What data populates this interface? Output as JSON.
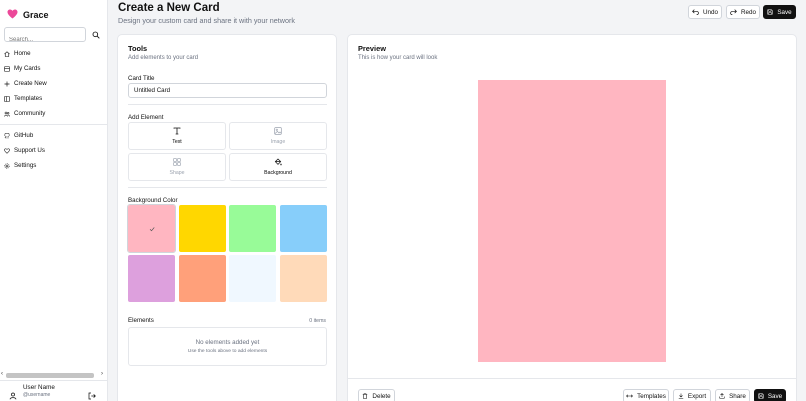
{
  "brand": {
    "name": "Grace",
    "logo_color": "#ec4899"
  },
  "search": {
    "placeholder": "Search..."
  },
  "nav": {
    "items": [
      {
        "label": "Home",
        "icon": "home-icon"
      },
      {
        "label": "My Cards",
        "icon": "cards-icon"
      },
      {
        "label": "Create New",
        "icon": "plus-icon"
      },
      {
        "label": "Templates",
        "icon": "template-icon"
      },
      {
        "label": "Community",
        "icon": "community-icon"
      }
    ],
    "secondary": [
      {
        "label": "GitHub",
        "icon": "github-icon"
      },
      {
        "label": "Support Us",
        "icon": "heart-icon"
      },
      {
        "label": "Settings",
        "icon": "gear-icon"
      }
    ]
  },
  "user": {
    "name": "User Name",
    "handle": "@username"
  },
  "header": {
    "title": "Create a New Card",
    "subtitle": "Design your custom card and share it with your network",
    "undo_label": "Undo",
    "redo_label": "Redo",
    "save_label": "Save"
  },
  "tools": {
    "title": "Tools",
    "subtitle": "Add elements to your card",
    "card_title_label": "Card Title",
    "card_title_value": "Untitled Card",
    "add_element_label": "Add Element",
    "elements": [
      {
        "label": "Text",
        "icon": "text-icon"
      },
      {
        "label": "Image",
        "icon": "image-icon"
      },
      {
        "label": "Shape",
        "icon": "shape-icon"
      },
      {
        "label": "Background",
        "icon": "paint-bucket-icon"
      }
    ],
    "background_color_label": "Background Color",
    "colors": [
      "#ffb6c1",
      "#ffd700",
      "#98fb98",
      "#87cefa",
      "#dda0dd",
      "#ffa07a",
      "#f0f8ff",
      "#ffdab9"
    ],
    "selected_color": "#ffb6c1",
    "elements_label": "Elements",
    "elements_count": "0 items",
    "empty_title": "No elements added yet",
    "empty_hint": "Use the tools above to add elements"
  },
  "preview": {
    "title": "Preview",
    "subtitle": "This is how your card will look",
    "card_color": "#ffb6c1",
    "delete_label": "Delete",
    "templates_label": "Templates",
    "export_label": "Export",
    "share_label": "Share",
    "save_label": "Save"
  }
}
